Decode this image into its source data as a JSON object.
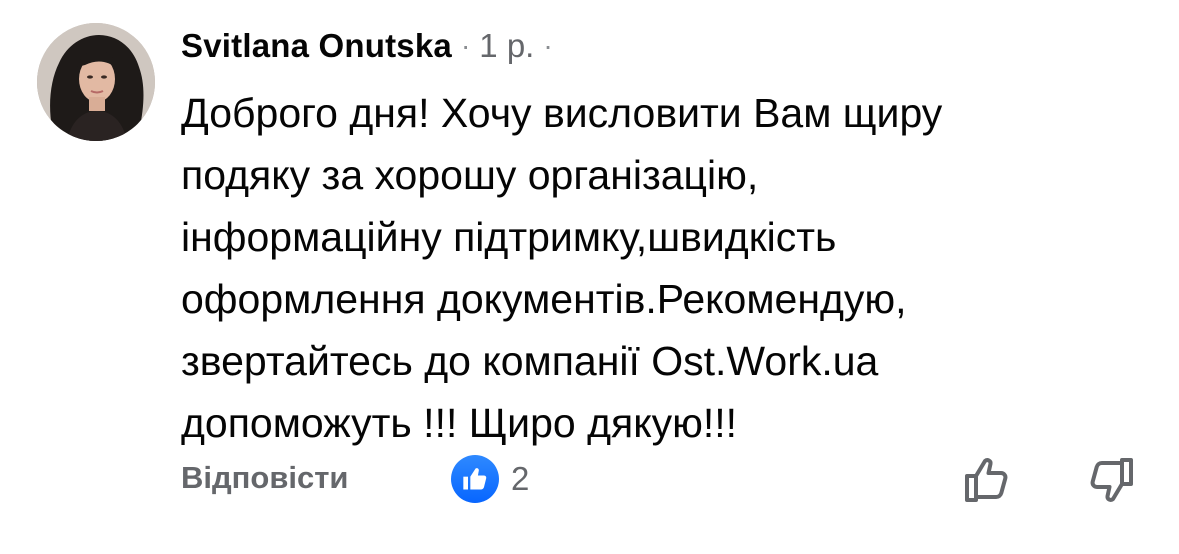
{
  "comment": {
    "author": "Svitlana Onutska",
    "separator_before": "·",
    "time": "1 р.",
    "separator_after": "·",
    "text_lines": [
      "Доброго дня! Хочу висловити Вам щиру",
      "подяку за хорошу організацію,",
      "інформаційну підтримку,швидкість",
      "оформлення документів.Рекомендую,",
      "звертайтесь до компанії Ost.Work.ua",
      "допоможуть !!! Щиро дякую!!!"
    ]
  },
  "actions": {
    "reply_label": "Відповісти",
    "like_count": "2",
    "reaction_icon": "like-reaction-icon",
    "upvote_icon": "thumb-up-icon",
    "downvote_icon": "thumb-down-icon"
  },
  "colors": {
    "text_primary": "#050505",
    "text_secondary": "#65676b",
    "like_blue": "#0866ff"
  }
}
